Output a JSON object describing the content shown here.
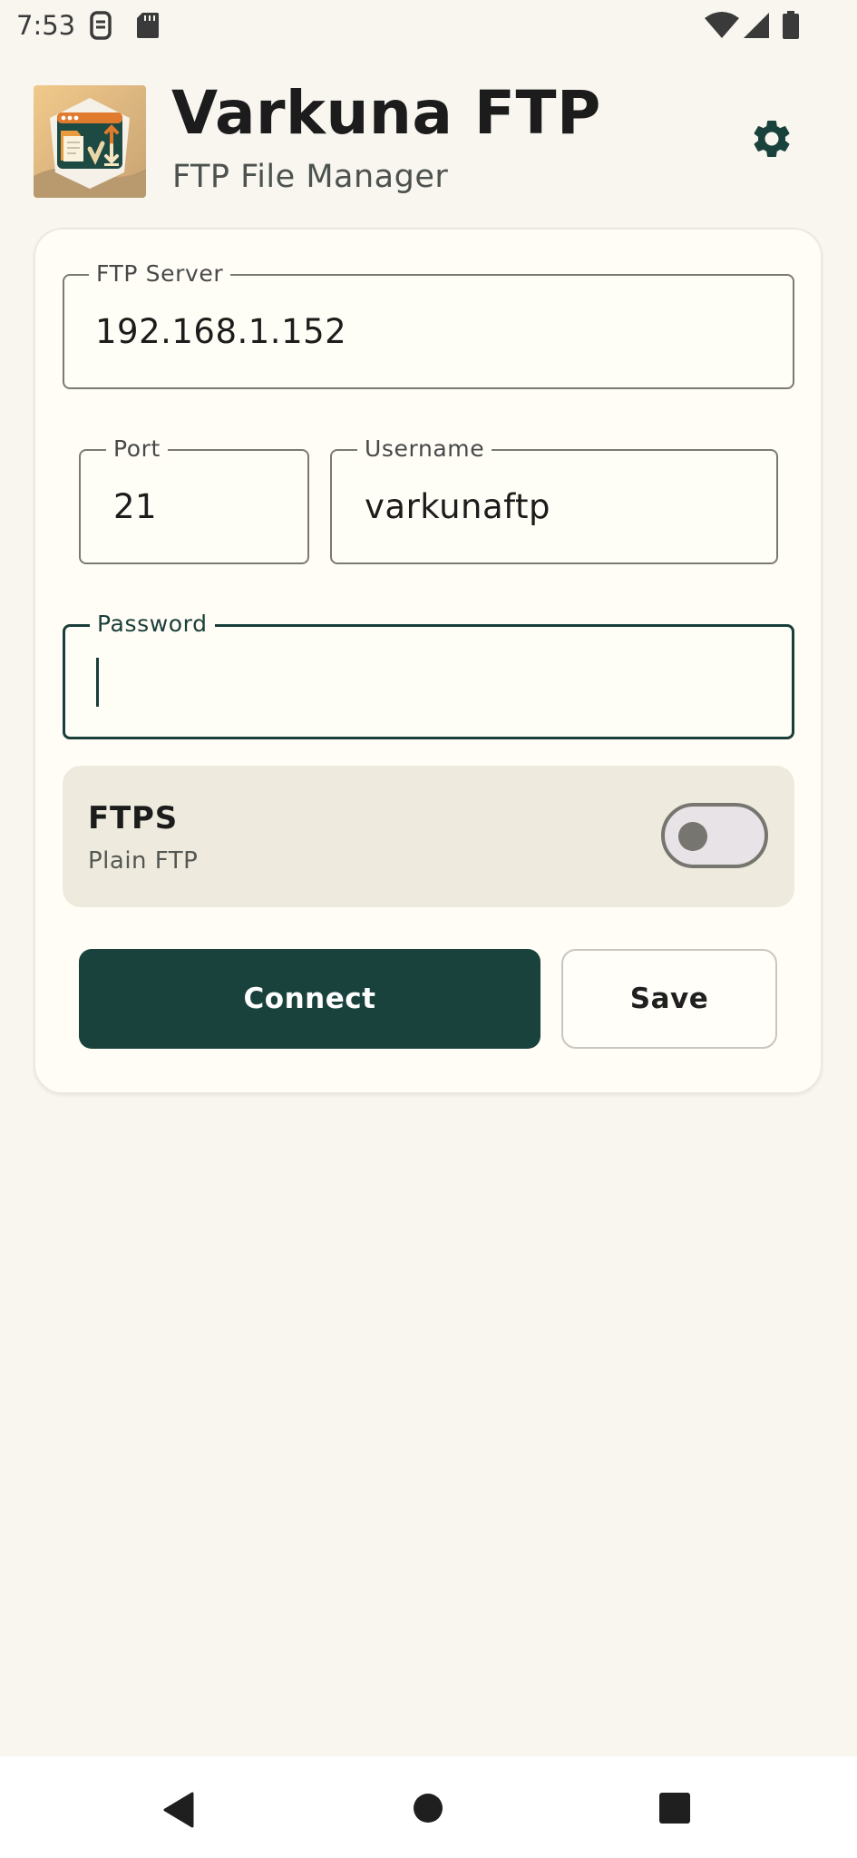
{
  "status_bar": {
    "time": "7:53"
  },
  "header": {
    "title": "Varkuna FTP",
    "subtitle": "FTP File Manager"
  },
  "form": {
    "server": {
      "label": "FTP Server",
      "value": "192.168.1.152"
    },
    "port": {
      "label": "Port",
      "value": "21"
    },
    "username": {
      "label": "Username",
      "value": "varkunaftp"
    },
    "password": {
      "label": "Password",
      "value": ""
    },
    "ftps": {
      "title": "FTPS",
      "subtitle": "Plain FTP",
      "enabled": false
    },
    "connect_label": "Connect",
    "save_label": "Save"
  },
  "colors": {
    "accent": "#1a423c",
    "background": "#f8f6ef",
    "card": "#fffdf5",
    "toggle_row": "#eeebde"
  },
  "icons": [
    "sim-icon",
    "sd-card-icon",
    "wifi-icon",
    "signal-icon",
    "battery-icon",
    "app-logo-icon",
    "gear-icon",
    "back-icon",
    "home-icon",
    "recents-icon"
  ]
}
